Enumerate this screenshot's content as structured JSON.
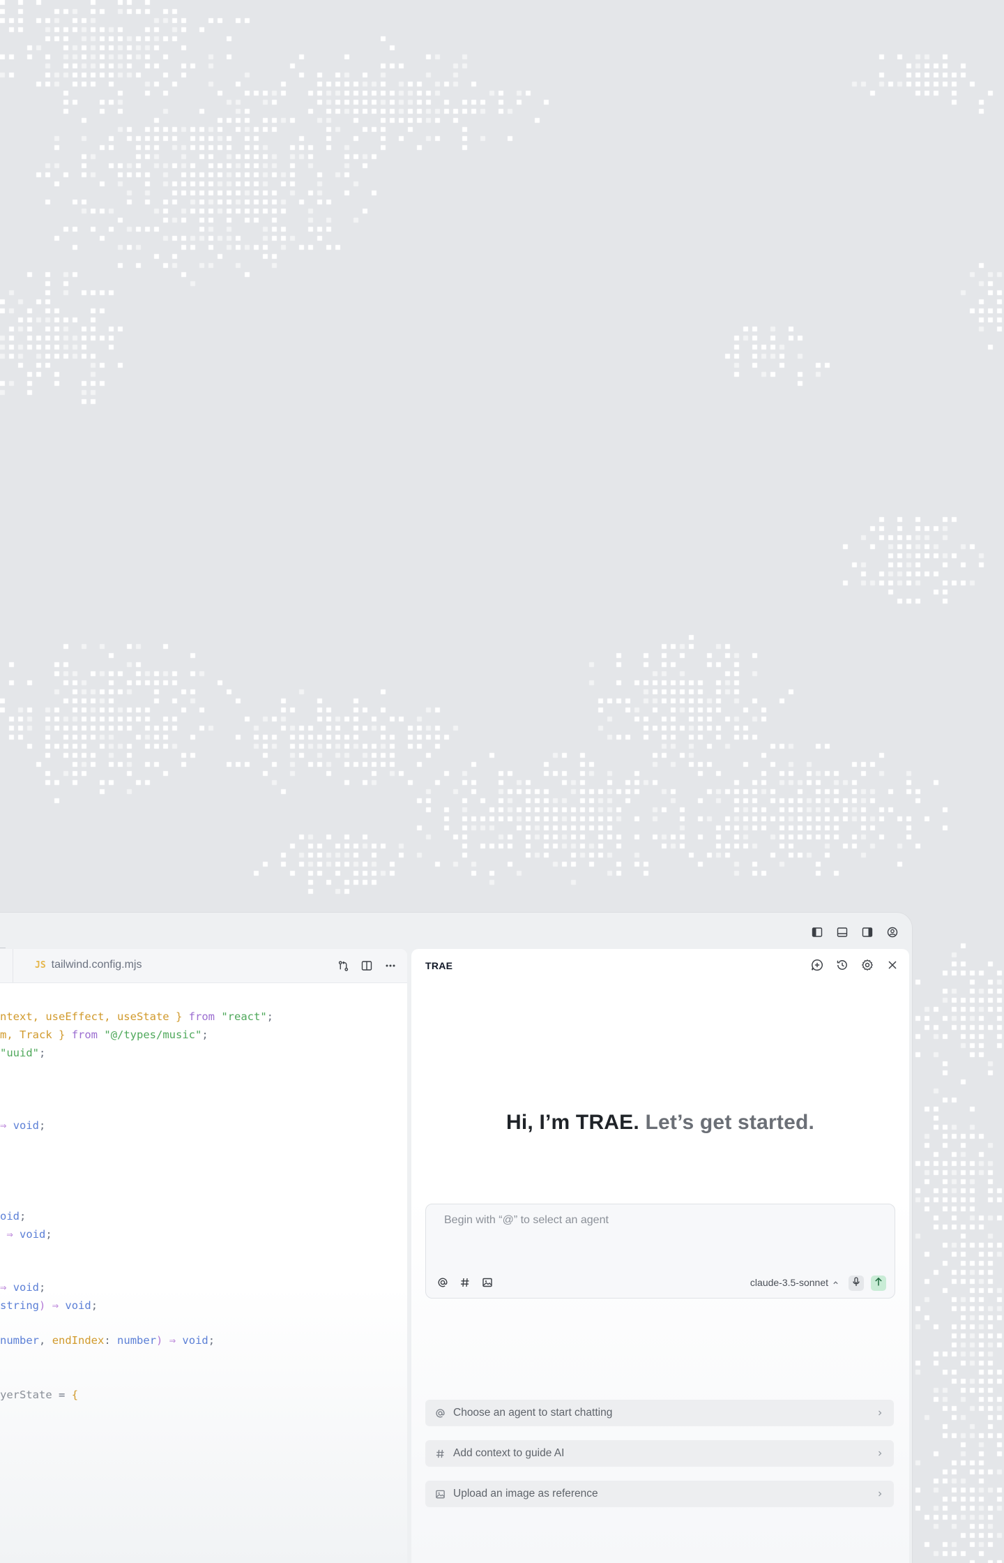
{
  "ide": {
    "editor": {
      "tab": {
        "lang_badge": "JS",
        "filename": "tailwind.config.mjs"
      },
      "code_lines": [
        "ntext, useEffect, useState } from \"react\";",
        "m, Track } from \"@/types/music\";",
        "\"uuid\";",
        "⇒ void;",
        "oid;",
        " ⇒ void;",
        "⇒ void;",
        "string) ⇒ void;",
        "number, endIndex: number) ⇒ void;",
        "yerState = {"
      ]
    },
    "chat": {
      "title": "TRAE",
      "greeting_primary": "Hi, I’m TRAE.",
      "greeting_secondary": "Let’s get started.",
      "input_placeholder": "Begin with “@” to select an agent",
      "model_name": "claude-3.5-sonnet",
      "suggestions": [
        {
          "icon": "at-icon",
          "label": "Choose an agent to start chatting"
        },
        {
          "icon": "hash-icon",
          "label": "Add context to guide AI"
        },
        {
          "icon": "image-icon",
          "label": "Upload an image as reference"
        }
      ]
    }
  },
  "colors": {
    "page_background": "#e4e6e9",
    "dot_pattern": "#ffffff",
    "send_button": "#c9ecd6",
    "keyword": "#9b6dd0",
    "string": "#4fa85b",
    "variable": "#d19a2c",
    "type": "#5b7fd6"
  }
}
